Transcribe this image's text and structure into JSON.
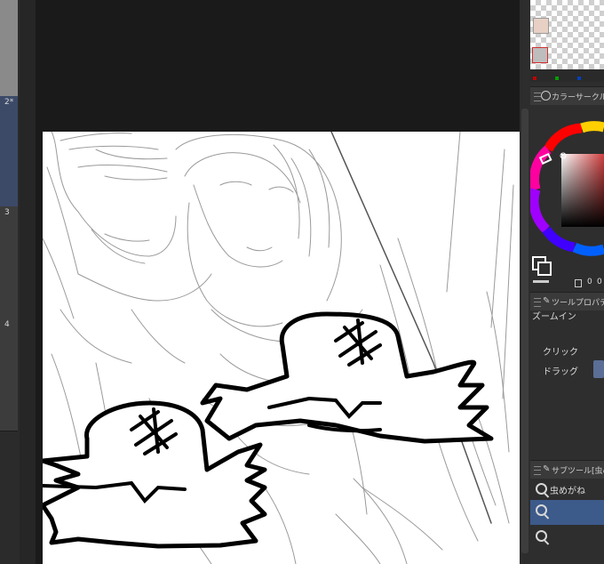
{
  "pages": [
    {
      "number": ""
    },
    {
      "number": "2*"
    },
    {
      "number": "3"
    },
    {
      "number": "4"
    }
  ],
  "color_panel": {
    "title": "カラーサークル",
    "swatch_colors": [
      "#e8d0c4",
      "#bdbdbd"
    ],
    "dot_colors": [
      "#c00000",
      "#00a000",
      "#0040c0"
    ],
    "info_values": [
      "0",
      "0"
    ]
  },
  "tool_property": {
    "title": "ツールプロパティ",
    "tool_name": "ズームイン",
    "click_label": "クリック",
    "drag_label": "ドラッグ"
  },
  "sub_tool": {
    "title": "サブツール[虫めがね]",
    "items": [
      {
        "label": "虫めがね",
        "selected": false
      },
      {
        "label": "",
        "selected": true
      },
      {
        "label": "",
        "selected": false
      }
    ]
  },
  "colors": {
    "accent": "#3c5a8a",
    "panel_bg": "#2e2e2e",
    "canvas_bg": "#ffffff",
    "workspace_bg": "#1a1a1a"
  }
}
